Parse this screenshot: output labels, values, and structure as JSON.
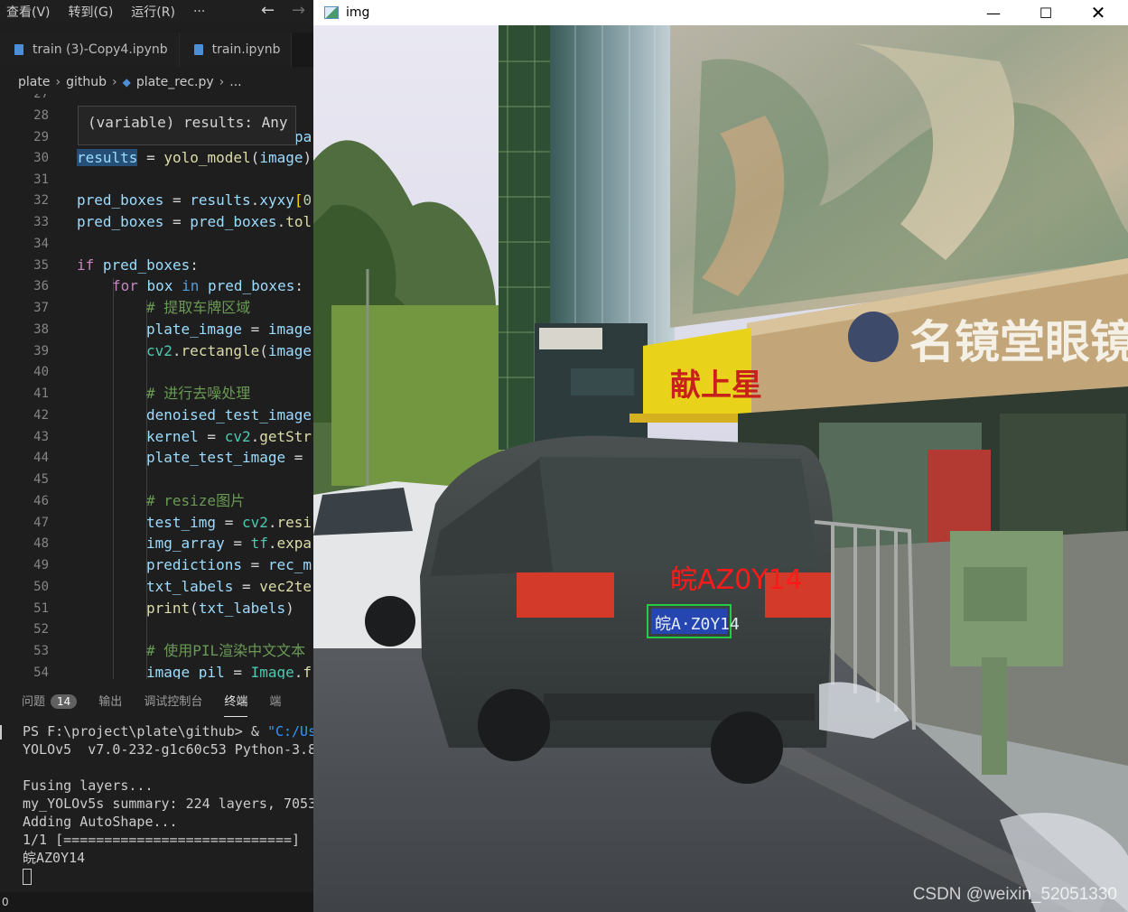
{
  "menubar": {
    "items": [
      "查看(V)",
      "转到(G)",
      "运行(R)",
      "···"
    ],
    "back_icon": "arrow-left-icon",
    "forward_icon": "arrow-right-icon"
  },
  "tabs": [
    {
      "label": "train (3)-Copy4.ipynb"
    },
    {
      "label": "train.ipynb"
    }
  ],
  "breadcrumb": [
    "plate",
    "github",
    "plate_rec.py",
    "..."
  ],
  "editor": {
    "hover_text": "(variable) results: Any",
    "lines": [
      {
        "n": "27",
        "text": ""
      },
      {
        "n": "28",
        "text": ""
      },
      {
        "n": "29",
        "text": "pa"
      },
      {
        "n": "30",
        "text": "results = yolo_model(image)"
      },
      {
        "n": "31",
        "text": ""
      },
      {
        "n": "32",
        "text": "pred_boxes = results.xyxy[0"
      },
      {
        "n": "33",
        "text": "pred_boxes = pred_boxes.tol"
      },
      {
        "n": "34",
        "text": ""
      },
      {
        "n": "35",
        "text": "if pred_boxes:"
      },
      {
        "n": "36",
        "text": "for box in pred_boxes:"
      },
      {
        "n": "37",
        "text": "# 提取车牌区域"
      },
      {
        "n": "38",
        "text": "plate_image = image"
      },
      {
        "n": "39",
        "text": "cv2.rectangle(image"
      },
      {
        "n": "40",
        "text": ""
      },
      {
        "n": "41",
        "text": "# 进行去噪处理"
      },
      {
        "n": "42",
        "text": "denoised_test_image"
      },
      {
        "n": "43",
        "text": "kernel = cv2.getStr"
      },
      {
        "n": "44",
        "text": "plate_test_image ="
      },
      {
        "n": "45",
        "text": ""
      },
      {
        "n": "46",
        "text": "# resize图片"
      },
      {
        "n": "47",
        "text": "test_img = cv2.resi"
      },
      {
        "n": "48",
        "text": "img_array = tf.expa"
      },
      {
        "n": "49",
        "text": "predictions = rec_m"
      },
      {
        "n": "50",
        "text": "txt_labels = vec2te"
      },
      {
        "n": "51",
        "text": "print(txt_labels)"
      },
      {
        "n": "52",
        "text": ""
      },
      {
        "n": "53",
        "text": "# 使用PIL渲染中文文本"
      },
      {
        "n": "54",
        "text": "image_pil = Image.f"
      }
    ]
  },
  "panel": {
    "tabs": [
      "问题",
      "输出",
      "调试控制台",
      "终端",
      "端"
    ],
    "problems_count": "14",
    "active_tab": "终端"
  },
  "terminal": {
    "prompt": "PS F:\\project\\plate\\github> & ",
    "cmd_str": "\"C:/Us",
    "lines": [
      "YOLOv5  v7.0-232-g1c60c53 Python-3.8",
      "",
      "Fusing layers...",
      "my_YOLOv5s summary: 224 layers, 7053",
      "Adding AutoShape...",
      "1/1 [============================]",
      "皖AZ0Y14"
    ]
  },
  "statusbar": {
    "text": "0"
  },
  "img_window": {
    "title": "img",
    "minimize_icon": "minimize-icon",
    "maximize_icon": "maximize-icon",
    "close_icon": "close-icon",
    "detected_label": "皖AZ0Y14",
    "plate_text": "皖A·Z0Y14",
    "sign_shop": "名镜堂眼镜",
    "sign_yellow": "献上星",
    "watermark": "CSDN @weixin_52051330",
    "colors": {
      "detection_label": "#ff1a1a",
      "detection_box": "#22cc44"
    }
  }
}
